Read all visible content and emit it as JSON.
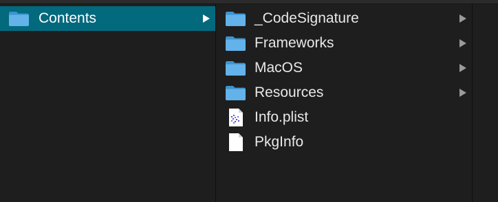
{
  "columns": [
    {
      "items": [
        {
          "label": "Contents",
          "icon": "folder-icon",
          "has_children": true,
          "selected": true
        }
      ]
    },
    {
      "items": [
        {
          "label": "_CodeSignature",
          "icon": "folder-icon",
          "has_children": true
        },
        {
          "label": "Frameworks",
          "icon": "folder-icon",
          "has_children": true
        },
        {
          "label": "MacOS",
          "icon": "folder-icon",
          "has_children": true
        },
        {
          "label": "Resources",
          "icon": "folder-icon",
          "has_children": true
        },
        {
          "label": "Info.plist",
          "icon": "plist-file-icon",
          "has_children": false
        },
        {
          "label": "PkgInfo",
          "icon": "document-icon",
          "has_children": false
        }
      ]
    }
  ],
  "colors": {
    "background": "#1e1e1e",
    "selection": "#03697d",
    "folder": "#5fb0e6",
    "text": "#e8e8e8",
    "chevron": "#9b9b9b"
  }
}
